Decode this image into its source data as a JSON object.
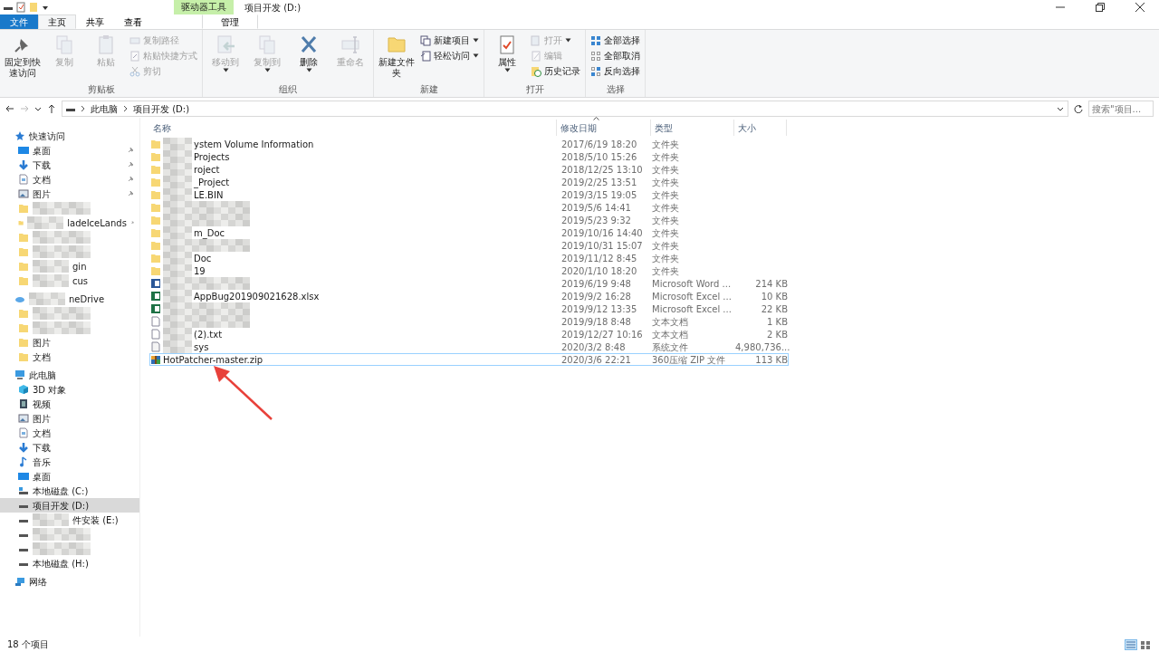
{
  "window": {
    "title": "项目开发 (D:)",
    "contextual_label": "驱动器工具"
  },
  "tabs": [
    {
      "label": "文件",
      "kind": "file",
      "selected": false
    },
    {
      "label": "主页",
      "kind": "normal",
      "selected": true
    },
    {
      "label": "共享",
      "kind": "normal",
      "selected": false
    },
    {
      "label": "查看",
      "kind": "normal",
      "selected": false
    },
    {
      "label": "管理",
      "kind": "contextual",
      "selected": false
    }
  ],
  "ribbon": [
    {
      "label": "剪贴板",
      "items": [
        {
          "label": "固定到快速访问",
          "kind": "large",
          "disabled": false,
          "dropdown": false
        },
        {
          "label": "复制",
          "kind": "large",
          "disabled": true,
          "dropdown": false
        },
        {
          "label": "粘贴",
          "kind": "large",
          "disabled": true,
          "dropdown": false
        },
        {
          "label": "复制路径",
          "kind": "small",
          "disabled": true,
          "dropdown": false
        },
        {
          "label": "粘贴快捷方式",
          "kind": "small",
          "disabled": true,
          "dropdown": false
        },
        {
          "label": "剪切",
          "kind": "small",
          "disabled": true,
          "dropdown": false
        }
      ]
    },
    {
      "label": "组织",
      "items": [
        {
          "label": "移动到",
          "kind": "large",
          "disabled": true,
          "dropdown": true
        },
        {
          "label": "复制到",
          "kind": "large",
          "disabled": true,
          "dropdown": true
        },
        {
          "label": "删除",
          "kind": "large",
          "disabled": false,
          "dropdown": true
        },
        {
          "label": "重命名",
          "kind": "large",
          "disabled": true,
          "dropdown": false
        }
      ]
    },
    {
      "label": "新建",
      "items": [
        {
          "label": "新建文件夹",
          "kind": "large",
          "disabled": false,
          "dropdown": false
        },
        {
          "label": "新建项目",
          "kind": "small",
          "disabled": false,
          "dropdown": true
        },
        {
          "label": "轻松访问",
          "kind": "small",
          "disabled": false,
          "dropdown": true
        }
      ]
    },
    {
      "label": "打开",
      "items": [
        {
          "label": "属性",
          "kind": "large",
          "disabled": false,
          "dropdown": true
        },
        {
          "label": "打开",
          "kind": "small",
          "disabled": true,
          "dropdown": true
        },
        {
          "label": "编辑",
          "kind": "small",
          "disabled": true,
          "dropdown": false
        },
        {
          "label": "历史记录",
          "kind": "small",
          "disabled": false,
          "dropdown": false
        }
      ]
    },
    {
      "label": "选择",
      "items": [
        {
          "label": "全部选择",
          "kind": "small",
          "disabled": false,
          "dropdown": false
        },
        {
          "label": "全部取消",
          "kind": "small",
          "disabled": false,
          "dropdown": false
        },
        {
          "label": "反向选择",
          "kind": "small",
          "disabled": false,
          "dropdown": false
        }
      ]
    }
  ],
  "address": {
    "breadcrumbs": [
      "此电脑",
      "项目开发 (D:)"
    ],
    "search_placeholder": "搜索\"项目...",
    "forward_disabled": true
  },
  "sidebar": [
    {
      "label": "快速访问",
      "kind": "quick-access",
      "pinned": false,
      "blurred": false,
      "selected": false
    },
    {
      "label": "桌面",
      "kind": "desktop",
      "pinned": true,
      "blurred": false,
      "selected": false
    },
    {
      "label": "下载",
      "kind": "download",
      "pinned": true,
      "blurred": false,
      "selected": false
    },
    {
      "label": "文档",
      "kind": "documents",
      "pinned": true,
      "blurred": false,
      "selected": false
    },
    {
      "label": "图片",
      "kind": "pictures",
      "pinned": true,
      "blurred": false,
      "selected": false
    },
    {
      "kind": "folder",
      "pinned": false,
      "blurred": true,
      "selected": false
    },
    {
      "label": "ladeIceLands",
      "kind": "folder",
      "pinned": true,
      "blurred": true,
      "selected": false
    },
    {
      "kind": "folder",
      "pinned": false,
      "blurred": true,
      "selected": false
    },
    {
      "kind": "folder",
      "pinned": false,
      "blurred": true,
      "selected": false
    },
    {
      "label": "gin",
      "kind": "folder",
      "pinned": false,
      "blurred": true,
      "selected": false
    },
    {
      "label": "cus",
      "kind": "folder",
      "pinned": false,
      "blurred": true,
      "selected": false
    },
    {
      "label": "neDrive",
      "kind": "onedrive",
      "pinned": false,
      "blurred": true,
      "selected": false
    },
    {
      "kind": "folder",
      "pinned": false,
      "blurred": true,
      "selected": false
    },
    {
      "kind": "folder",
      "pinned": false,
      "blurred": true,
      "selected": false
    },
    {
      "label": "图片",
      "kind": "folder",
      "pinned": false,
      "blurred": false,
      "selected": false
    },
    {
      "label": "文档",
      "kind": "folder",
      "pinned": false,
      "blurred": false,
      "selected": false
    },
    {
      "label": "此电脑",
      "kind": "this-pc",
      "pinned": false,
      "blurred": false,
      "selected": false
    },
    {
      "label": "3D 对象",
      "kind": "objects3d",
      "pinned": false,
      "blurred": false,
      "selected": false
    },
    {
      "label": "视频",
      "kind": "videos",
      "pinned": false,
      "blurred": false,
      "selected": false
    },
    {
      "label": "图片",
      "kind": "pictures",
      "pinned": false,
      "blurred": false,
      "selected": false
    },
    {
      "label": "文档",
      "kind": "documents",
      "pinned": false,
      "blurred": false,
      "selected": false
    },
    {
      "label": "下载",
      "kind": "download",
      "pinned": false,
      "blurred": false,
      "selected": false
    },
    {
      "label": "音乐",
      "kind": "music",
      "pinned": false,
      "blurred": false,
      "selected": false
    },
    {
      "label": "桌面",
      "kind": "desktop",
      "pinned": false,
      "blurred": false,
      "selected": false
    },
    {
      "label": "本地磁盘 (C:)",
      "kind": "system-drive",
      "pinned": false,
      "blurred": false,
      "selected": false
    },
    {
      "label": "项目开发 (D:)",
      "kind": "drive",
      "pinned": false,
      "blurred": false,
      "selected": true
    },
    {
      "label": "件安装 (E:)",
      "kind": "drive",
      "pinned": false,
      "blurred": true,
      "selected": false
    },
    {
      "kind": "drive",
      "pinned": false,
      "blurred": true,
      "selected": false
    },
    {
      "kind": "drive",
      "pinned": false,
      "blurred": true,
      "selected": false
    },
    {
      "label": "本地磁盘 (H:)",
      "kind": "drive",
      "pinned": false,
      "blurred": false,
      "selected": false
    },
    {
      "label": "网络",
      "kind": "network",
      "pinned": false,
      "blurred": false,
      "selected": false
    }
  ],
  "table": {
    "columns": [
      {
        "label": "名称",
        "sorted": false
      },
      {
        "label": "修改日期",
        "sorted": true
      },
      {
        "label": "类型",
        "sorted": false
      },
      {
        "label": "大小",
        "sorted": false
      }
    ],
    "rows": [
      {
        "name": "ystem Volume Information",
        "kind": "folder",
        "blurred": true,
        "date": "2017/6/19 18:20",
        "type": "文件夹",
        "selected": false
      },
      {
        "name": "Projects",
        "kind": "folder",
        "blurred": true,
        "date": "2018/5/10 15:26",
        "type": "文件夹",
        "selected": false
      },
      {
        "name": "roject",
        "kind": "folder",
        "blurred": true,
        "date": "2018/12/25 13:10",
        "type": "文件夹",
        "selected": false
      },
      {
        "name": "_Project",
        "kind": "folder",
        "blurred": true,
        "date": "2019/2/25 13:51",
        "type": "文件夹",
        "selected": false
      },
      {
        "name": "LE.BIN",
        "kind": "folder",
        "blurred": true,
        "date": "2019/3/15 19:05",
        "type": "文件夹",
        "selected": false
      },
      {
        "kind": "folder",
        "blurred": true,
        "date": "2019/5/6 14:41",
        "type": "文件夹",
        "selected": false
      },
      {
        "kind": "folder",
        "blurred": true,
        "date": "2019/5/23 9:32",
        "type": "文件夹",
        "selected": false
      },
      {
        "name": "m_Doc",
        "kind": "folder",
        "blurred": true,
        "date": "2019/10/16 14:40",
        "type": "文件夹",
        "selected": false
      },
      {
        "kind": "folder",
        "blurred": true,
        "date": "2019/10/31 15:07",
        "type": "文件夹",
        "selected": false
      },
      {
        "name": "Doc",
        "kind": "folder",
        "blurred": true,
        "date": "2019/11/12 8:45",
        "type": "文件夹",
        "selected": false
      },
      {
        "name": "19",
        "kind": "folder",
        "blurred": true,
        "date": "2020/1/10 18:20",
        "type": "文件夹",
        "selected": false
      },
      {
        "kind": "word",
        "blurred": true,
        "date": "2019/6/19 9:48",
        "type": "Microsoft Word ...",
        "size": "214 KB",
        "selected": false
      },
      {
        "name": "AppBug201909021628.xlsx",
        "kind": "excel",
        "blurred": true,
        "date": "2019/9/2 16:28",
        "type": "Microsoft Excel ...",
        "size": "10 KB",
        "selected": false
      },
      {
        "kind": "excel",
        "blurred": true,
        "date": "2019/9/12 13:35",
        "type": "Microsoft Excel ...",
        "size": "22 KB",
        "selected": false
      },
      {
        "kind": "text",
        "blurred": true,
        "date": "2019/9/18 8:48",
        "type": "文本文档",
        "size": "1 KB",
        "selected": false
      },
      {
        "name": "(2).txt",
        "kind": "text",
        "blurred": true,
        "date": "2019/12/27 10:16",
        "type": "文本文档",
        "size": "2 KB",
        "selected": false
      },
      {
        "name": "sys",
        "kind": "system",
        "blurred": true,
        "date": "2020/3/2 8:48",
        "type": "系统文件",
        "size": "4,980,736...",
        "selected": false
      },
      {
        "name": "HotPatcher-master.zip",
        "kind": "zip",
        "blurred": false,
        "date": "2020/3/6 22:21",
        "type": "360压缩 ZIP 文件",
        "size": "113 KB",
        "selected": true
      }
    ]
  },
  "annotation": {
    "kind": "arrow",
    "color": "#e8413a"
  },
  "status_bar": {
    "count": "18 个项目",
    "details_view": true
  }
}
